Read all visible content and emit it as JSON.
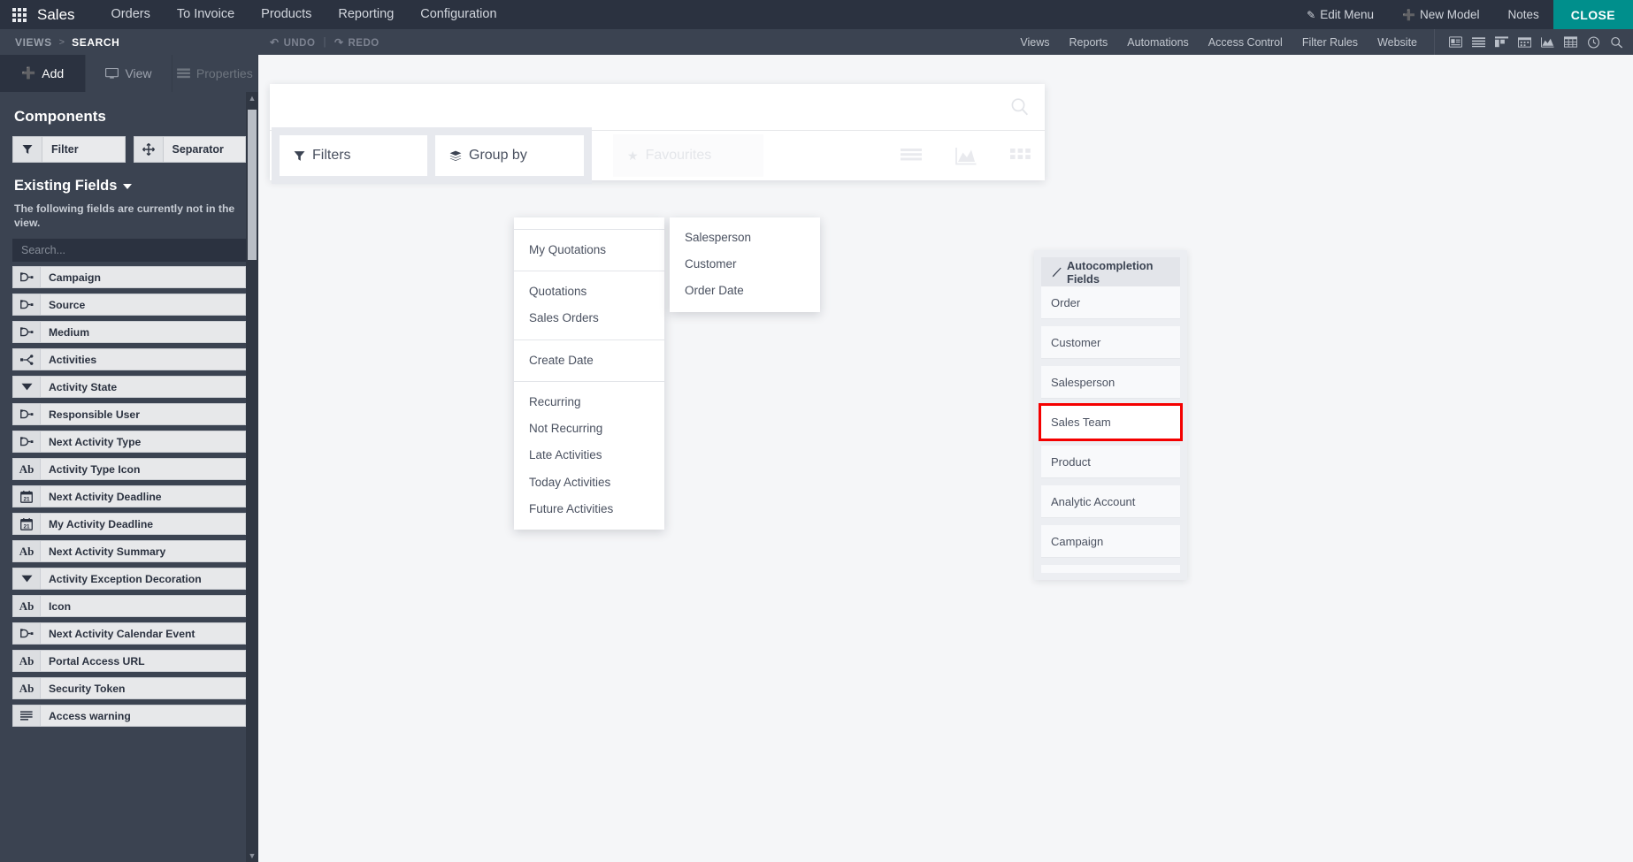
{
  "navbar": {
    "apps_icon": "apps-grid-icon",
    "brand": "Sales",
    "menu": [
      "Orders",
      "To Invoice",
      "Products",
      "Reporting",
      "Configuration"
    ],
    "right": {
      "edit_menu": "Edit Menu",
      "new_model": "New Model",
      "notes": "Notes",
      "close": "CLOSE",
      "close_color": "#008f8c"
    }
  },
  "subbar": {
    "breadcrumb": {
      "root": "VIEWS",
      "separator": ">",
      "current": "SEARCH"
    },
    "undo": "UNDO",
    "redo": "REDO",
    "links": [
      "Views",
      "Reports",
      "Automations",
      "Access Control",
      "Filter Rules",
      "Website"
    ],
    "view_icons": [
      "form-icon",
      "list-icon",
      "kanban-icon",
      "calendar-icon",
      "graph-icon",
      "pivot-icon",
      "activity-clock-icon",
      "search-icon"
    ]
  },
  "sidebar": {
    "tabs": [
      {
        "label": "Add",
        "icon": "plus-icon",
        "active": true
      },
      {
        "label": "View",
        "icon": "monitor-icon",
        "active": false
      },
      {
        "label": "Properties",
        "icon": "properties-icon",
        "active": false,
        "disabled": true
      }
    ],
    "components_title": "Components",
    "components": [
      {
        "label": "Filter",
        "icon": "funnel-icon"
      },
      {
        "label": "Separator",
        "icon": "move-cross-icon"
      }
    ],
    "existing_fields_title": "Existing Fields",
    "existing_fields_note": "The following fields are currently not in the view.",
    "search_placeholder": "Search...",
    "fields": [
      {
        "label": "Campaign",
        "icon": "many2one-icon"
      },
      {
        "label": "Source",
        "icon": "many2one-icon"
      },
      {
        "label": "Medium",
        "icon": "many2one-icon"
      },
      {
        "label": "Activities",
        "icon": "one2many-icon"
      },
      {
        "label": "Activity State",
        "icon": "selection-icon"
      },
      {
        "label": "Responsible User",
        "icon": "many2one-icon"
      },
      {
        "label": "Next Activity Type",
        "icon": "many2one-icon"
      },
      {
        "label": "Activity Type Icon",
        "icon": "char-icon"
      },
      {
        "label": "Next Activity Deadline",
        "icon": "date-icon"
      },
      {
        "label": "My Activity Deadline",
        "icon": "date-icon"
      },
      {
        "label": "Next Activity Summary",
        "icon": "char-icon"
      },
      {
        "label": "Activity Exception Decoration",
        "icon": "selection-icon"
      },
      {
        "label": "Icon",
        "icon": "char-icon"
      },
      {
        "label": "Next Activity Calendar Event",
        "icon": "many2one-icon"
      },
      {
        "label": "Portal Access URL",
        "icon": "char-icon"
      },
      {
        "label": "Security Token",
        "icon": "char-icon"
      },
      {
        "label": "Access warning",
        "icon": "text-icon"
      }
    ]
  },
  "canvas": {
    "search_view": {
      "search_icon": "search-icon",
      "dropdowns": [
        {
          "label": "Filters",
          "icon": "funnel-icon"
        },
        {
          "label": "Group by",
          "icon": "layers-icon"
        }
      ],
      "favourites": {
        "label": "Favourites",
        "icon": "star-icon"
      },
      "view_toggles": [
        "list-icon",
        "graph-icon",
        "kanban-grid-icon"
      ]
    },
    "filters_menu": [
      {
        "items": []
      },
      {
        "items": [
          "My Quotations"
        ]
      },
      {
        "items": [
          "Quotations",
          "Sales Orders"
        ]
      },
      {
        "items": [
          "Create Date"
        ]
      },
      {
        "items": [
          "Recurring",
          "Not Recurring",
          "Late Activities",
          "Today Activities",
          "Future Activities"
        ]
      }
    ],
    "groupby_menu": [
      "Salesperson",
      "Customer",
      "Order Date"
    ],
    "autocompletion": {
      "title": "Autocompletion Fields",
      "icon": "magic-wand-icon",
      "items": [
        {
          "label": "Order",
          "selected": false
        },
        {
          "label": "Customer",
          "selected": false
        },
        {
          "label": "Salesperson",
          "selected": false
        },
        {
          "label": "Sales Team",
          "selected": true
        },
        {
          "label": "Product",
          "selected": false
        },
        {
          "label": "Analytic Account",
          "selected": false
        },
        {
          "label": "Campaign",
          "selected": false
        }
      ],
      "highlight_color": "#f40000"
    }
  }
}
